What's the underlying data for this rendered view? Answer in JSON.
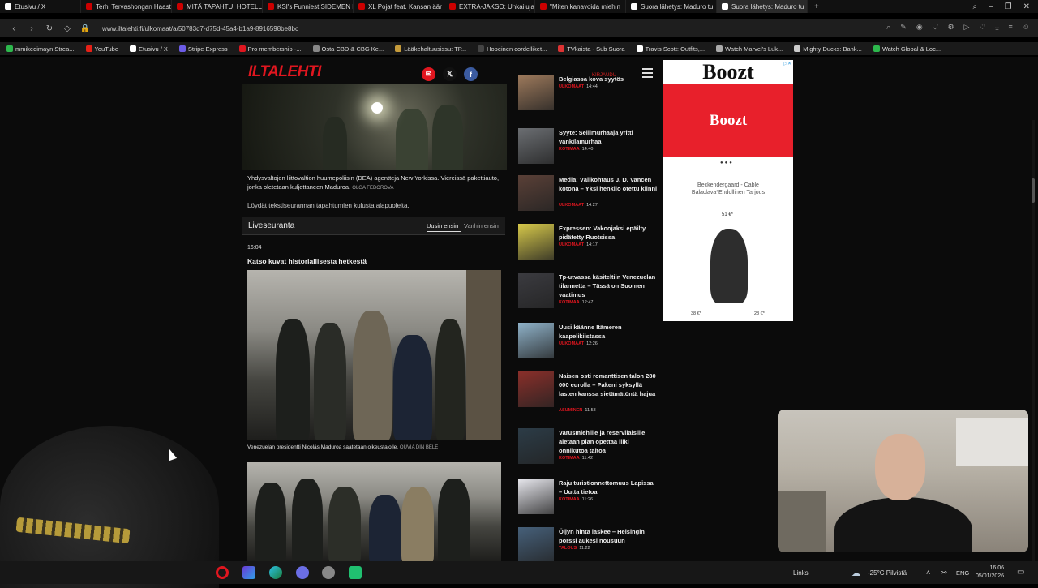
{
  "browser": {
    "tabs": [
      {
        "label": "Etusivu / X",
        "active": false
      },
      {
        "label": "Terhi Tervashongan Haast",
        "active": false
      },
      {
        "label": "MITÄ TAPAHTUI HOTELLI",
        "active": false
      },
      {
        "label": "KSI's Funniest SIDEMEN M",
        "active": false
      },
      {
        "label": "XL Pojat feat. Kansan äär",
        "active": false
      },
      {
        "label": "EXTRA-JAKSO: Uhkailuja",
        "active": false
      },
      {
        "label": "\"Miten kanavoida miehin",
        "active": false
      },
      {
        "label": "Suora lähetys: Maduro tu",
        "active": false
      },
      {
        "label": "Suora lähetys: Maduro tu",
        "active": true
      }
    ],
    "new_tab": "+",
    "url": "www.iltalehti.fi/ulkomaat/a/50783d7-d75d-45a4-b1a9-8916598be8bc",
    "bookmarks": [
      {
        "label": "mmikedimayn Strea...",
        "color": "#2db84d"
      },
      {
        "label": "YouTube",
        "color": "#e62117"
      },
      {
        "label": "Etusivu / X",
        "color": "#ffffff"
      },
      {
        "label": "Stripe Express",
        "color": "#6c5ce7"
      },
      {
        "label": "Pro membership -...",
        "color": "#e0161f"
      },
      {
        "label": "Osta CBD & CBG Ke...",
        "color": "#888888"
      },
      {
        "label": "Lääkehaltuusissu: TP...",
        "color": "#c59b3b"
      },
      {
        "label": "Hopeinen cordelliket...",
        "color": "#444444"
      },
      {
        "label": "TVkaista - Sub Suora",
        "color": "#d33"
      },
      {
        "label": "Travis Scott: Outfits,...",
        "color": "#ffffff"
      },
      {
        "label": "Watch Marvel's Luk...",
        "color": "#aaaaaa"
      },
      {
        "label": "Mighty Ducks: Bank...",
        "color": "#cccccc"
      },
      {
        "label": "Watch Global & Loc...",
        "color": "#2db84d"
      }
    ]
  },
  "site": {
    "logo": "ILTALEHTI",
    "sub_label": "KIRJAUDU",
    "hero_caption": "Yhdysvaltojen liittovaltion huumepoliisin (DEA) agentteja New Yorkissa. Viereissä pakettiauto, jonka oletetaan kuljettaneen Maduroa.",
    "hero_credit": "OLGA FEDOROVA",
    "intro_text": "Löydät tekstiseurannan tapahtumien kulusta alapuolelta.",
    "live": {
      "title": "Liveseuranta",
      "sort_newest": "Uusin ensin",
      "sort_oldest": "Vanhin ensin",
      "time": "16:04",
      "headline": "Katso kuvat historiallisesta hetkestä",
      "photo1_caption": "Venezuelan presidentti Nicolás Maduroa saatetaan oikeustaloile.",
      "photo1_credit": "OUVIA DIN BELE"
    }
  },
  "news": [
    {
      "title": "Belgiassa kova syytös",
      "tag": "ULKOMAAT",
      "time": "14:44",
      "thumb": "#9e7a5c"
    },
    {
      "title": "Syyte: Sellimurhaaja yritti vankilamurhaa",
      "tag": "KOTIMAA",
      "time": "14:40",
      "thumb": "#6b6e72"
    },
    {
      "title": "Media: Välikohtaus J. D. Vancen kotona – Yksi henkilö otettu kiinni",
      "tag": "ULKOMAAT",
      "time": "14:27",
      "thumb": "#5a4037"
    },
    {
      "title": "Expressen: Vakoojaksi epäilty pidätetty Ruotsissa",
      "tag": "ULKOMAAT",
      "time": "14:17",
      "thumb": "#d7c94a"
    },
    {
      "title": "Tp-utvassa käsiteltiin Venezuelan tilannetta – Tässä on Suomen vaatimus",
      "tag": "KOTIMAA",
      "time": "12:47",
      "thumb": "#3b3b40"
    },
    {
      "title": "Uusi käänne Itämeren kaapelikiistassa",
      "tag": "ULKOMAAT",
      "time": "12:26",
      "thumb": "#8fb2c9"
    },
    {
      "title": "Naisen osti romanttisen talon 280 000 eurolla – Pakeni syksyllä lasten kanssa sietämätöntä hajua",
      "tag": "ASUMINEN",
      "time": "11:58",
      "thumb": "#8a2f2a"
    },
    {
      "title": "Varusmiehille ja reserviläisille aletaan pian opettaa iliki onnikutoa taitoa",
      "tag": "KOTIMAA",
      "time": "11:42",
      "thumb": "#2c3c47"
    },
    {
      "title": "Raju turistionnettomuus Lapissa – Uutta tietoa",
      "tag": "KOTIMAA",
      "time": "11:26",
      "thumb": "#e8e8ee"
    },
    {
      "title": "Öljyn hinta laskee – Helsingin pörssi aukesi nousuun",
      "tag": "TALOUS",
      "time": "11:22",
      "thumb": "#46607a"
    }
  ],
  "ad": {
    "brand": "Boozt",
    "banner_brand": "Boozt",
    "dots": "●●●",
    "product": "Beckendergaard - Cable Balaclava*Ehdollinen Tarjous",
    "price": "51 €*",
    "bottom_left": "38 €*",
    "bottom_right": "28 €*",
    "adchoice": "▷✕"
  },
  "taskbar": {
    "links": "Links",
    "weather": "-25°C  Pilvistä",
    "lang": "ENG",
    "time": "16.06",
    "date": "05/01/2026"
  },
  "colors": {
    "brand_red": "#e0161f",
    "page_bg": "#0b0b0b",
    "ad_red": "#e8202b"
  }
}
